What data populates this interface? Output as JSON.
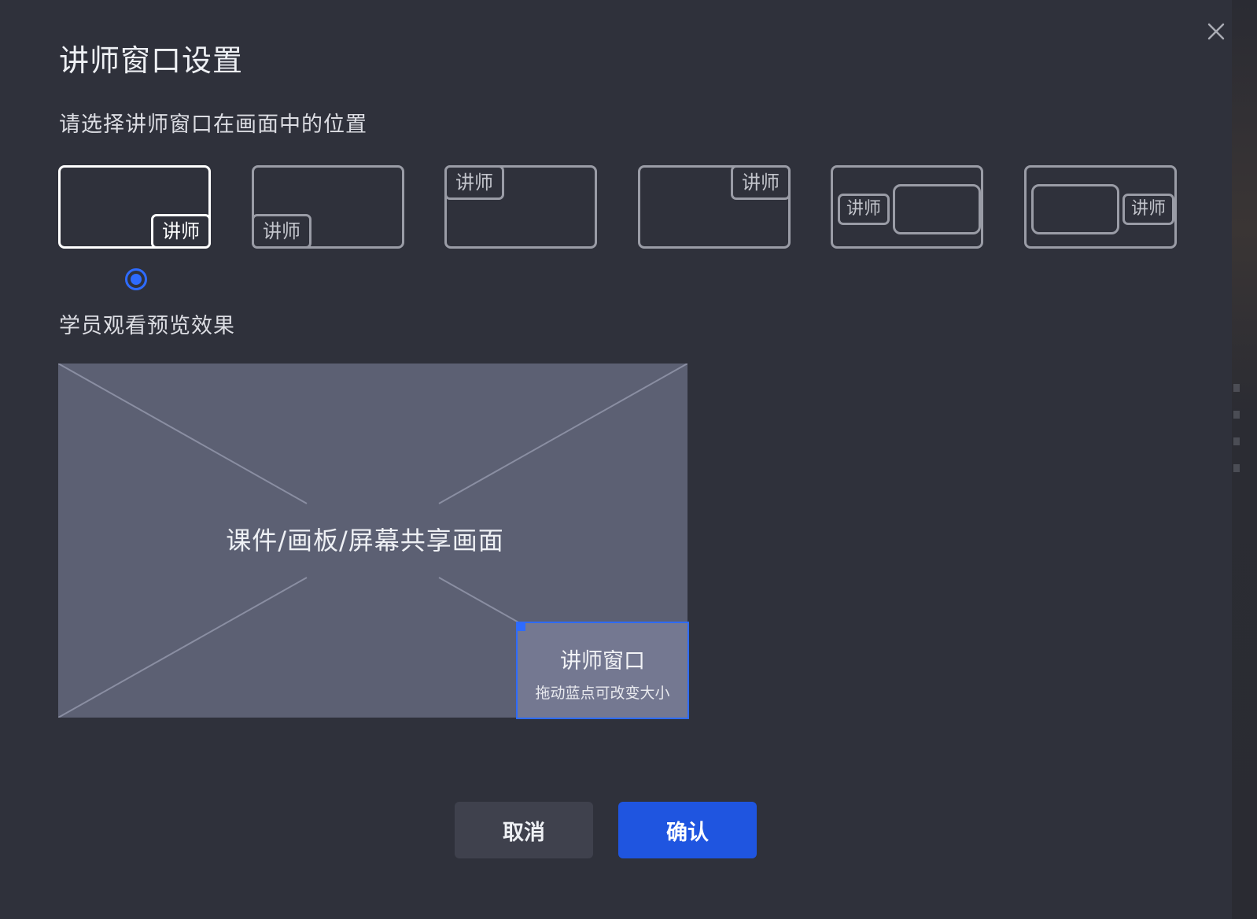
{
  "dialog": {
    "title": "讲师窗口设置",
    "position_prompt": "请选择讲师窗口在画面中的位置",
    "preview_label": "学员观看预览效果"
  },
  "layout_options": [
    {
      "id": "bottom-right",
      "tag": "讲师",
      "selected": true
    },
    {
      "id": "bottom-left",
      "tag": "讲师",
      "selected": false
    },
    {
      "id": "top-left",
      "tag": "讲师",
      "selected": false
    },
    {
      "id": "top-right",
      "tag": "讲师",
      "selected": false
    },
    {
      "id": "side-left",
      "tag": "讲师",
      "selected": false
    },
    {
      "id": "side-right",
      "tag": "讲师",
      "selected": false
    }
  ],
  "preview": {
    "content_label": "课件/画板/屏幕共享画面",
    "teacher_window_title": "讲师窗口",
    "teacher_window_hint": "拖动蓝点可改变大小"
  },
  "buttons": {
    "cancel": "取消",
    "confirm": "确认"
  },
  "colors": {
    "background": "#2f313b",
    "accent": "#2e6bff",
    "confirm_button": "#1f55e0",
    "preview_area": "#5c6073"
  },
  "icons": {
    "close": "close-icon"
  }
}
